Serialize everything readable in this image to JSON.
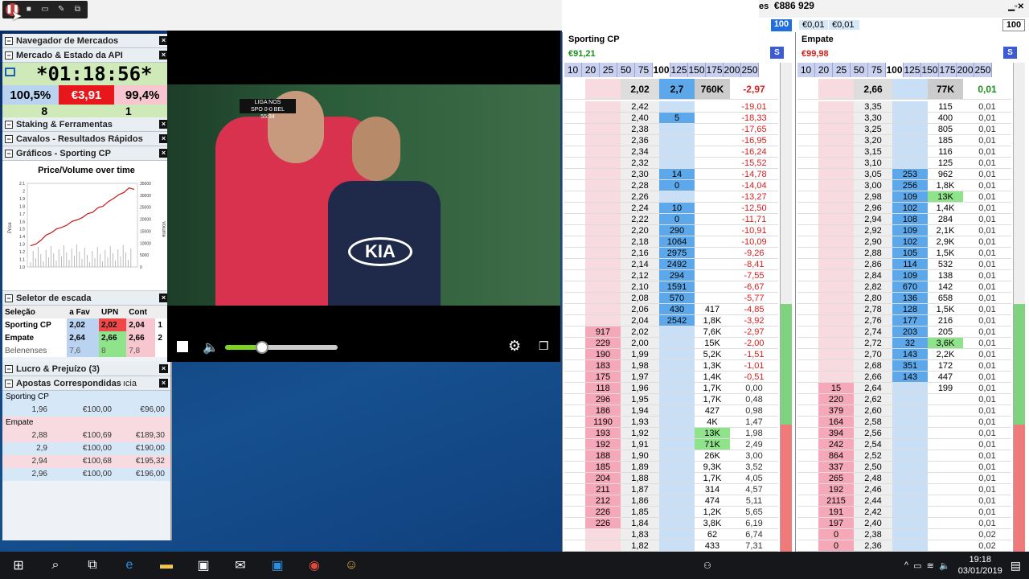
{
  "app": {
    "balance_label": "es",
    "balance": "€886 929",
    "stake_box": "100",
    "stake_box2": "100"
  },
  "left": {
    "panels": [
      "Navegador de Mercados",
      "Mercado & Estado da API"
    ],
    "clock": "*01:18:56*",
    "pct_back": "100,5%",
    "pct_mid": "€3,91",
    "pct_lay": "99,4%",
    "count_left": "8",
    "count_right": "1",
    "panels2": [
      "Staking & Ferramentas",
      "Cavalos - Resultados Rápidos",
      "Gráficos - Sporting CP"
    ],
    "chart_title": "Price/Volume over time",
    "ladder_panel": "Seletor de escada",
    "ladder_cols": [
      "Seleção",
      "a Fav",
      "UPN",
      "Cont"
    ],
    "ladder_rows": [
      [
        "Sporting CP",
        "2,02",
        "2,02",
        "2,04",
        "1"
      ],
      [
        "Empate",
        "2,64",
        "2,66",
        "2,66",
        "2"
      ],
      [
        "Belenenses",
        "7,6",
        "8",
        "7,8",
        ""
      ]
    ],
    "pl_panel": "Lucro & Prejuízo (3)",
    "bets_panel": "Apostas Correspondidas",
    "bets_suffix": "ıcia",
    "bets": [
      {
        "group": "Sporting CP",
        "rows": [
          [
            "1,96",
            "€100,00",
            "€96,00"
          ]
        ]
      },
      {
        "group": "Empate",
        "rows": [
          [
            "2,88",
            "€100,69",
            "€189,30"
          ],
          [
            "2,9",
            "€100,00",
            "€190,00"
          ],
          [
            "2,94",
            "€100,68",
            "€195,32"
          ],
          [
            "2,96",
            "€100,00",
            "€196,00"
          ]
        ]
      }
    ]
  },
  "chart_data": {
    "type": "line",
    "title": "Price/Volume over time",
    "ylabel": "Price",
    "y2label": "Volume",
    "yticks": [
      "2.1",
      "2",
      "1.9",
      "1.8",
      "1.7",
      "1.6",
      "1.5",
      "1.4",
      "1.3",
      "1.2",
      "1.1",
      "1.0"
    ],
    "y2ticks": [
      "35000",
      "30000",
      "25000",
      "20000",
      "15000",
      "10000",
      "5000",
      "0"
    ],
    "price": [
      1.28,
      1.3,
      1.35,
      1.42,
      1.45,
      1.5,
      1.52,
      1.55,
      1.6,
      1.62,
      1.65,
      1.7,
      1.72,
      1.78,
      1.8,
      1.86,
      1.9,
      1.95,
      1.98,
      2.04,
      2.02
    ]
  },
  "video": {
    "score_line1": "LIGA NOS",
    "score_line2": "SPO 0-0 BEL",
    "score_line3": "55:34",
    "kia": "KIA"
  },
  "ladders": [
    {
      "name": "Sporting CP",
      "pl": "€91,21",
      "stake_label": "€0,01",
      "hdr": [
        "",
        "",
        "2,02",
        "2,7",
        "760K",
        "-2,97"
      ],
      "rows": [
        [
          "",
          "",
          "2,42",
          "",
          "",
          "-19,01"
        ],
        [
          "",
          "",
          "2,40",
          "5",
          "",
          "-18,33"
        ],
        [
          "",
          "",
          "2,38",
          "",
          "",
          "-17,65"
        ],
        [
          "",
          "",
          "2,36",
          "",
          "",
          "-16,95"
        ],
        [
          "",
          "",
          "2,34",
          "",
          "",
          "-16,24"
        ],
        [
          "",
          "",
          "2,32",
          "",
          "",
          "-15,52"
        ],
        [
          "",
          "",
          "2,30",
          "14",
          "",
          "-14,78"
        ],
        [
          "",
          "",
          "2,28",
          "0",
          "",
          "-14,04"
        ],
        [
          "",
          "",
          "2,26",
          "",
          "",
          "-13,27"
        ],
        [
          "",
          "",
          "2,24",
          "10",
          "",
          "-12,50"
        ],
        [
          "",
          "",
          "2,22",
          "0",
          "",
          "-11,71"
        ],
        [
          "",
          "",
          "2,20",
          "290",
          "",
          "-10,91"
        ],
        [
          "",
          "",
          "2,18",
          "1064",
          "",
          "-10,09"
        ],
        [
          "",
          "",
          "2,16",
          "2975",
          "",
          "-9,26"
        ],
        [
          "",
          "",
          "2,14",
          "2492",
          "",
          "-8,41"
        ],
        [
          "",
          "",
          "2,12",
          "294",
          "",
          "-7,55"
        ],
        [
          "",
          "",
          "2,10",
          "1591",
          "",
          "-6,67"
        ],
        [
          "",
          "",
          "2,08",
          "570",
          "",
          "-5,77"
        ],
        [
          "",
          "",
          "2,06",
          "430",
          "417",
          "-4,85"
        ],
        [
          "",
          "",
          "2,04",
          "2542",
          "1,8K",
          "-3,92"
        ],
        [
          "",
          "917",
          "2,02",
          "",
          "7,6K",
          "-2,97"
        ],
        [
          "",
          "229",
          "2,00",
          "",
          "15K",
          "-2,00"
        ],
        [
          "",
          "190",
          "1,99",
          "",
          "5,2K",
          "-1,51"
        ],
        [
          "",
          "183",
          "1,98",
          "",
          "1,3K",
          "-1,01"
        ],
        [
          "",
          "175",
          "1,97",
          "",
          "1,4K",
          "-0,51"
        ],
        [
          "",
          "118",
          "1,96",
          "",
          "1,7K",
          "0,00"
        ],
        [
          "",
          "296",
          "1,95",
          "",
          "1,7K",
          "0,48"
        ],
        [
          "",
          "186",
          "1,94",
          "",
          "427",
          "0,98"
        ],
        [
          "",
          "1190",
          "1,93",
          "",
          "4K",
          "1,47"
        ],
        [
          "",
          "193",
          "1,92",
          "",
          "13K",
          "1,98"
        ],
        [
          "",
          "192",
          "1,91",
          "",
          "71K",
          "2,49"
        ],
        [
          "",
          "188",
          "1,90",
          "",
          "26K",
          "3,00"
        ],
        [
          "",
          "185",
          "1,89",
          "",
          "9,3K",
          "3,52"
        ],
        [
          "",
          "204",
          "1,88",
          "",
          "1,7K",
          "4,05"
        ],
        [
          "",
          "211",
          "1,87",
          "",
          "314",
          "4,57"
        ],
        [
          "",
          "212",
          "1,86",
          "",
          "474",
          "5,11"
        ],
        [
          "",
          "226",
          "1,85",
          "",
          "1,2K",
          "5,65"
        ],
        [
          "",
          "226",
          "1,84",
          "",
          "3,8K",
          "6,19"
        ],
        [
          "",
          "",
          "1,83",
          "",
          "62",
          "6,74"
        ],
        [
          "",
          "",
          "1,82",
          "",
          "433",
          "7,31"
        ]
      ]
    },
    {
      "name": "Empate",
      "pl": "€99,98",
      "stake_label": "€0,01",
      "hdr": [
        "",
        "",
        "2,66",
        "",
        "77K",
        "0,01"
      ],
      "rows": [
        [
          "",
          "",
          "3,35",
          "",
          "115",
          "0,01"
        ],
        [
          "",
          "",
          "3,30",
          "",
          "400",
          "0,01"
        ],
        [
          "",
          "",
          "3,25",
          "",
          "805",
          "0,01"
        ],
        [
          "",
          "",
          "3,20",
          "",
          "185",
          "0,01"
        ],
        [
          "",
          "",
          "3,15",
          "",
          "116",
          "0,01"
        ],
        [
          "",
          "",
          "3,10",
          "",
          "125",
          "0,01"
        ],
        [
          "",
          "",
          "3,05",
          "253",
          "962",
          "0,01"
        ],
        [
          "",
          "",
          "3,00",
          "256",
          "1,8K",
          "0,01"
        ],
        [
          "",
          "",
          "2,98",
          "109",
          "13K",
          "0,01"
        ],
        [
          "",
          "",
          "2,96",
          "102",
          "1,4K",
          "0,01"
        ],
        [
          "",
          "",
          "2,94",
          "108",
          "284",
          "0,01"
        ],
        [
          "",
          "",
          "2,92",
          "109",
          "2,1K",
          "0,01"
        ],
        [
          "",
          "",
          "2,90",
          "102",
          "2,9K",
          "0,01"
        ],
        [
          "",
          "",
          "2,88",
          "105",
          "1,5K",
          "0,01"
        ],
        [
          "",
          "",
          "2,86",
          "114",
          "532",
          "0,01"
        ],
        [
          "",
          "",
          "2,84",
          "109",
          "138",
          "0,01"
        ],
        [
          "",
          "",
          "2,82",
          "670",
          "142",
          "0,01"
        ],
        [
          "",
          "",
          "2,80",
          "136",
          "658",
          "0,01"
        ],
        [
          "",
          "",
          "2,78",
          "128",
          "1,5K",
          "0,01"
        ],
        [
          "",
          "",
          "2,76",
          "177",
          "216",
          "0,01"
        ],
        [
          "",
          "",
          "2,74",
          "203",
          "205",
          "0,01"
        ],
        [
          "",
          "",
          "2,72",
          "32",
          "3,6K",
          "0,01"
        ],
        [
          "",
          "",
          "2,70",
          "143",
          "2,2K",
          "0,01"
        ],
        [
          "",
          "",
          "2,68",
          "351",
          "172",
          "0,01"
        ],
        [
          "",
          "",
          "2,66",
          "143",
          "447",
          "0,01"
        ],
        [
          "",
          "15",
          "2,64",
          "",
          "199",
          "0,01"
        ],
        [
          "",
          "220",
          "2,62",
          "",
          "",
          "0,01"
        ],
        [
          "",
          "379",
          "2,60",
          "",
          "",
          "0,01"
        ],
        [
          "",
          "164",
          "2,58",
          "",
          "",
          "0,01"
        ],
        [
          "",
          "394",
          "2,56",
          "",
          "",
          "0,01"
        ],
        [
          "",
          "242",
          "2,54",
          "",
          "",
          "0,01"
        ],
        [
          "",
          "864",
          "2,52",
          "",
          "",
          "0,01"
        ],
        [
          "",
          "337",
          "2,50",
          "",
          "",
          "0,01"
        ],
        [
          "",
          "265",
          "2,48",
          "",
          "",
          "0,01"
        ],
        [
          "",
          "192",
          "2,46",
          "",
          "",
          "0,01"
        ],
        [
          "",
          "2115",
          "2,44",
          "",
          "",
          "0,01"
        ],
        [
          "",
          "191",
          "2,42",
          "",
          "",
          "0,01"
        ],
        [
          "",
          "197",
          "2,40",
          "",
          "",
          "0,01"
        ],
        [
          "",
          "0",
          "2,38",
          "",
          "",
          "0,02"
        ],
        [
          "",
          "0",
          "2,36",
          "",
          "",
          "0,02"
        ]
      ]
    }
  ],
  "stake_steps": [
    "10",
    "20",
    "25",
    "50",
    "75",
    "100",
    "125",
    "150",
    "175",
    "200",
    "250"
  ],
  "taskbar": {
    "time": "19:18",
    "date": "03/01/2019"
  }
}
